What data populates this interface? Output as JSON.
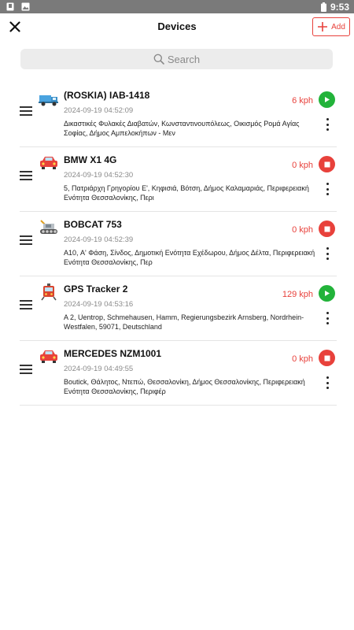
{
  "status_bar": {
    "time": "9:53"
  },
  "app_bar": {
    "title": "Devices",
    "add_label": "Add"
  },
  "search": {
    "placeholder": "Search"
  },
  "colors": {
    "accent": "#e8413b",
    "moving": "#22b33a",
    "stopped": "#e8413b"
  },
  "devices": [
    {
      "name": "(ROSKIA) IAB-1418",
      "timestamp": "2024-09-19 04:52:09",
      "address": "Δικαστικές Φυλακές Διαβατών, Κωνσταντινουπόλεως, Οικισμός Ρομά Αγίας Σοφίας, Δήμος Αμπελοκήπων - Μεν",
      "speed": "6 kph",
      "status": "moving",
      "icon": "truck-icon"
    },
    {
      "name": "BMW X1 4G",
      "timestamp": "2024-09-19 04:52:30",
      "address": "5, Πατριάρχη Γρηγορίου Ε', Κηφισιά, Βότση, Δήμος Καλαμαριάς, Περιφερειακή Ενότητα Θεσσαλονίκης, Περι",
      "speed": "0 kph",
      "status": "stopped",
      "icon": "car-icon"
    },
    {
      "name": "BOBCAT 753",
      "timestamp": "2024-09-19 04:52:39",
      "address": "A10, Α' Φάση, Σίνδος, Δημοτική Ενότητα Εχέδωρου, Δήμος Δέλτα, Περιφερειακή Ενότητα Θεσσαλονίκης, Περ",
      "speed": "0 kph",
      "status": "stopped",
      "icon": "bobcat-icon"
    },
    {
      "name": "GPS Tracker 2",
      "timestamp": "2024-09-19 04:53:16",
      "address": "A 2, Uentrop, Schmehausen, Hamm, Regierungsbezirk Arnsberg, Nordrhein-Westfalen, 59071, Deutschland",
      "speed": "129 kph",
      "status": "moving",
      "icon": "train-icon"
    },
    {
      "name": "MERCEDES NZM1001",
      "timestamp": "2024-09-19 04:49:55",
      "address": "Boutick, Θάλητος, Ντεπώ, Θεσσαλονίκη, Δήμος Θεσσαλονίκης, Περιφερειακή Ενότητα Θεσσαλονίκης, Περιφέρ",
      "speed": "0 kph",
      "status": "stopped",
      "icon": "car-icon"
    }
  ]
}
